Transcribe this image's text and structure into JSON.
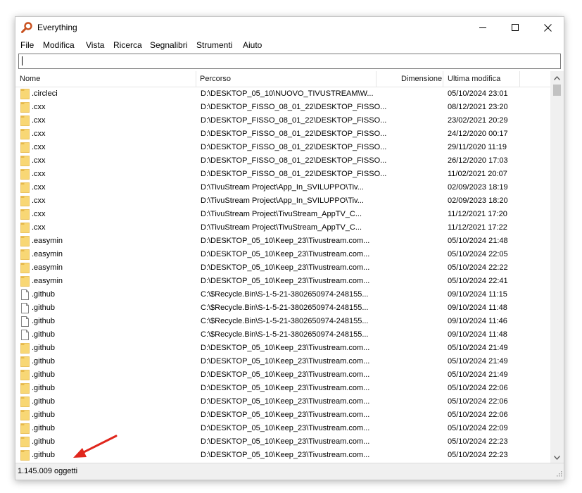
{
  "window": {
    "title": "Everything",
    "icon": "magnifier-icon",
    "buttons": [
      "minimize-icon",
      "maximize-icon",
      "close-icon"
    ]
  },
  "menu": [
    "File",
    "Modifica",
    "Vista",
    "Ricerca",
    "Segnalibri",
    "Strumenti",
    "Aiuto"
  ],
  "search": {
    "value": ""
  },
  "columns": {
    "name": "Nome",
    "path": "Percorso",
    "size": "Dimensione",
    "modified": "Ultima modifica"
  },
  "rows": [
    {
      "name": ".circleci",
      "path": "D:\\DESKTOP_05_10\\NUOVO_TIVUSTREAM\\W...",
      "modified": "05/10/2024 23:01",
      "type": "folder"
    },
    {
      "name": ".cxx",
      "path": "D:\\DESKTOP_FISSO_08_01_22\\DESKTOP_FISSO...",
      "modified": "08/12/2021 23:20",
      "type": "folder"
    },
    {
      "name": ".cxx",
      "path": "D:\\DESKTOP_FISSO_08_01_22\\DESKTOP_FISSO...",
      "modified": "23/02/2021 20:29",
      "type": "folder"
    },
    {
      "name": ".cxx",
      "path": "D:\\DESKTOP_FISSO_08_01_22\\DESKTOP_FISSO...",
      "modified": "24/12/2020 00:17",
      "type": "folder"
    },
    {
      "name": ".cxx",
      "path": "D:\\DESKTOP_FISSO_08_01_22\\DESKTOP_FISSO...",
      "modified": "29/11/2020 11:19",
      "type": "folder"
    },
    {
      "name": ".cxx",
      "path": "D:\\DESKTOP_FISSO_08_01_22\\DESKTOP_FISSO...",
      "modified": "26/12/2020 17:03",
      "type": "folder"
    },
    {
      "name": ".cxx",
      "path": "D:\\DESKTOP_FISSO_08_01_22\\DESKTOP_FISSO...",
      "modified": "11/02/2021 20:07",
      "type": "folder"
    },
    {
      "name": ".cxx",
      "path": "D:\\TivuStream Project\\App_In_SVILUPPO\\Tiv...",
      "modified": "02/09/2023 18:19",
      "type": "folder"
    },
    {
      "name": ".cxx",
      "path": "D:\\TivuStream Project\\App_In_SVILUPPO\\Tiv...",
      "modified": "02/09/2023 18:20",
      "type": "folder"
    },
    {
      "name": ".cxx",
      "path": "D:\\TivuStream Project\\TivuStream_AppTV_C...",
      "modified": "11/12/2021 17:20",
      "type": "folder"
    },
    {
      "name": ".cxx",
      "path": "D:\\TivuStream Project\\TivuStream_AppTV_C...",
      "modified": "11/12/2021 17:22",
      "type": "folder"
    },
    {
      "name": ".easymin",
      "path": "D:\\DESKTOP_05_10\\Keep_23\\Tivustream.com...",
      "modified": "05/10/2024 21:48",
      "type": "folder"
    },
    {
      "name": ".easymin",
      "path": "D:\\DESKTOP_05_10\\Keep_23\\Tivustream.com...",
      "modified": "05/10/2024 22:05",
      "type": "folder"
    },
    {
      "name": ".easymin",
      "path": "D:\\DESKTOP_05_10\\Keep_23\\Tivustream.com...",
      "modified": "05/10/2024 22:22",
      "type": "folder"
    },
    {
      "name": ".easymin",
      "path": "D:\\DESKTOP_05_10\\Keep_23\\Tivustream.com...",
      "modified": "05/10/2024 22:41",
      "type": "folder"
    },
    {
      "name": ".github",
      "path": "C:\\$Recycle.Bin\\S-1-5-21-3802650974-248155...",
      "modified": "09/10/2024 11:15",
      "type": "file"
    },
    {
      "name": ".github",
      "path": "C:\\$Recycle.Bin\\S-1-5-21-3802650974-248155...",
      "modified": "09/10/2024 11:48",
      "type": "file"
    },
    {
      "name": ".github",
      "path": "C:\\$Recycle.Bin\\S-1-5-21-3802650974-248155...",
      "modified": "09/10/2024 11:46",
      "type": "file"
    },
    {
      "name": ".github",
      "path": "C:\\$Recycle.Bin\\S-1-5-21-3802650974-248155...",
      "modified": "09/10/2024 11:48",
      "type": "file"
    },
    {
      "name": ".github",
      "path": "D:\\DESKTOP_05_10\\Keep_23\\Tivustream.com...",
      "modified": "05/10/2024 21:49",
      "type": "folder"
    },
    {
      "name": ".github",
      "path": "D:\\DESKTOP_05_10\\Keep_23\\Tivustream.com...",
      "modified": "05/10/2024 21:49",
      "type": "folder"
    },
    {
      "name": ".github",
      "path": "D:\\DESKTOP_05_10\\Keep_23\\Tivustream.com...",
      "modified": "05/10/2024 21:49",
      "type": "folder"
    },
    {
      "name": ".github",
      "path": "D:\\DESKTOP_05_10\\Keep_23\\Tivustream.com...",
      "modified": "05/10/2024 22:06",
      "type": "folder"
    },
    {
      "name": ".github",
      "path": "D:\\DESKTOP_05_10\\Keep_23\\Tivustream.com...",
      "modified": "05/10/2024 22:06",
      "type": "folder"
    },
    {
      "name": ".github",
      "path": "D:\\DESKTOP_05_10\\Keep_23\\Tivustream.com...",
      "modified": "05/10/2024 22:06",
      "type": "folder"
    },
    {
      "name": ".github",
      "path": "D:\\DESKTOP_05_10\\Keep_23\\Tivustream.com...",
      "modified": "05/10/2024 22:09",
      "type": "folder"
    },
    {
      "name": ".github",
      "path": "D:\\DESKTOP_05_10\\Keep_23\\Tivustream.com...",
      "modified": "05/10/2024 22:23",
      "type": "folder"
    },
    {
      "name": ".github",
      "path": "D:\\DESKTOP_05_10\\Keep_23\\Tivustream.com...",
      "modified": "05/10/2024 22:23",
      "type": "folder"
    }
  ],
  "status": {
    "count": "1.145.009 oggetti"
  },
  "annotation": {
    "icon": "red-arrow-icon",
    "color": "#e0261c"
  },
  "colors": {
    "folder": "#f8d775",
    "folder_tab": "#e6b84a",
    "accent_icon": "#c8501e"
  }
}
